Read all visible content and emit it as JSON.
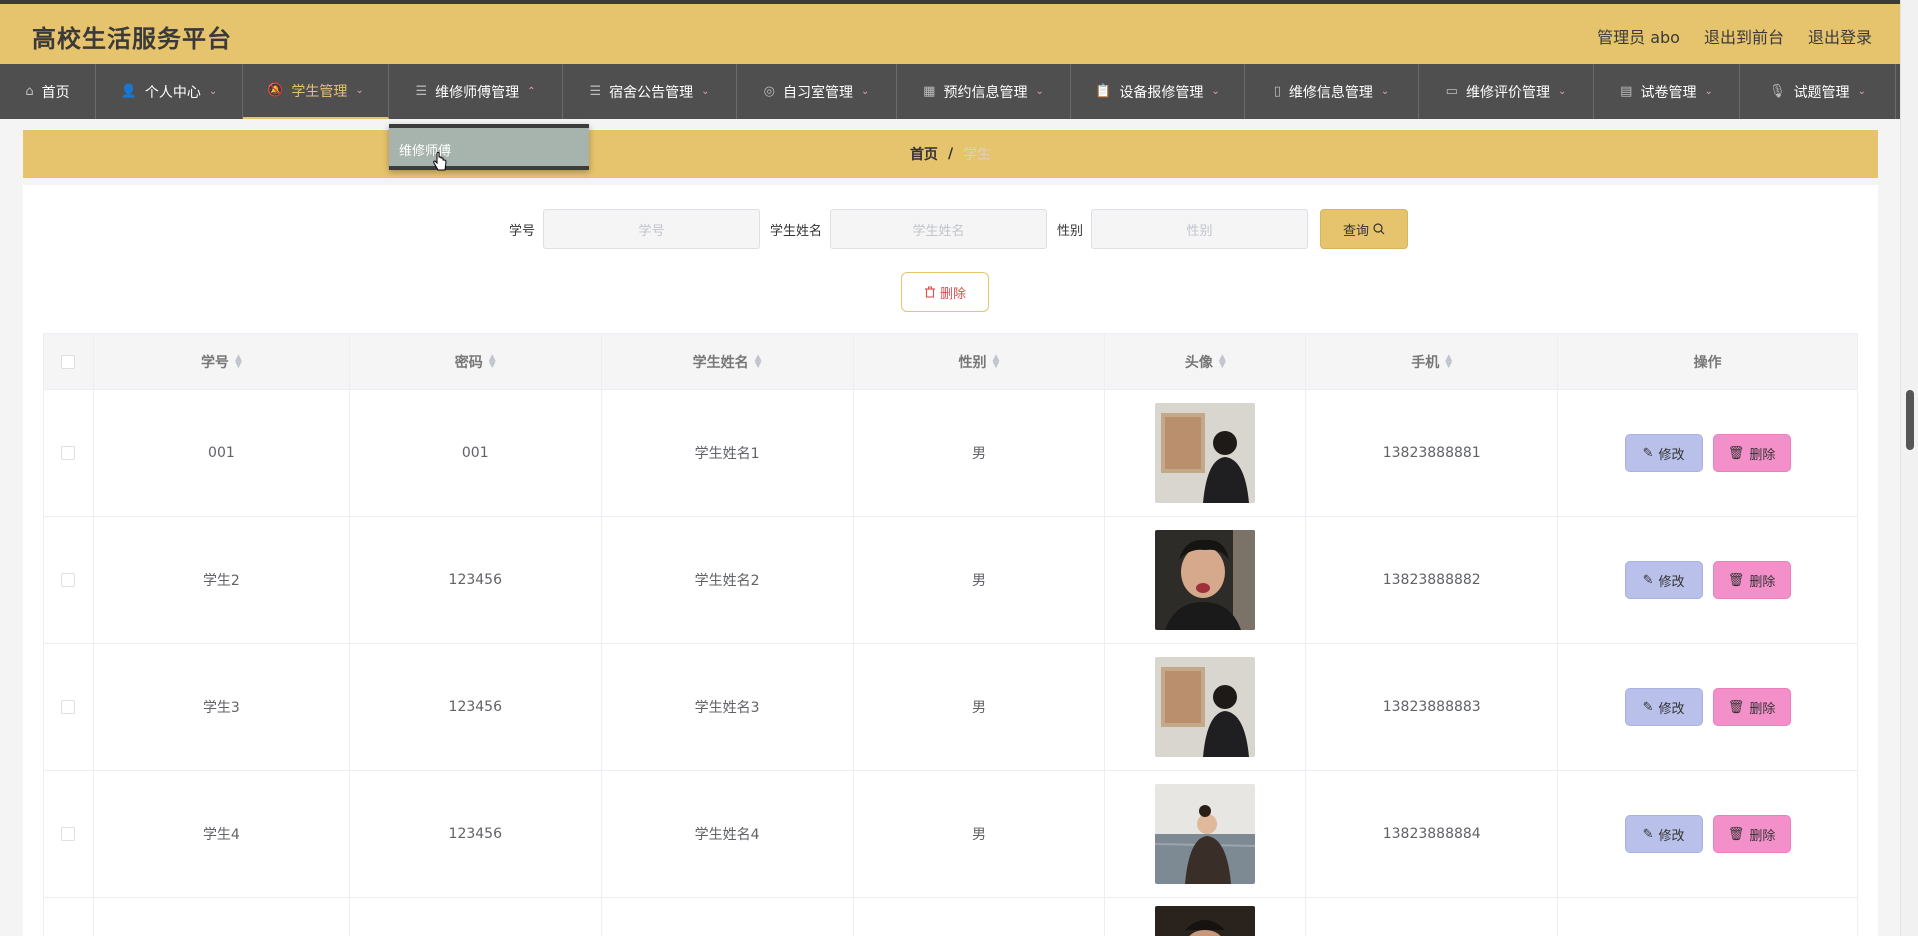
{
  "app": {
    "title": "高校生活服务平台"
  },
  "header": {
    "user_label": "管理员 abo",
    "to_front": "退出到前台",
    "logout": "退出登录"
  },
  "nav": [
    {
      "label": "首页",
      "icon": "home-icon",
      "has_menu": false
    },
    {
      "label": "个人中心",
      "icon": "user-icon",
      "has_menu": true
    },
    {
      "label": "学生管理",
      "icon": "bell-icon",
      "has_menu": true,
      "active": true
    },
    {
      "label": "维修师傅管理",
      "icon": "list-icon",
      "has_menu": true,
      "open": true
    },
    {
      "label": "宿舍公告管理",
      "icon": "list-icon",
      "has_menu": true
    },
    {
      "label": "自习室管理",
      "icon": "compass-icon",
      "has_menu": true
    },
    {
      "label": "预约信息管理",
      "icon": "grid-icon",
      "has_menu": true
    },
    {
      "label": "设备报修管理",
      "icon": "clipboard-icon",
      "has_menu": true
    },
    {
      "label": "维修信息管理",
      "icon": "mobile-icon",
      "has_menu": true
    },
    {
      "label": "维修评价管理",
      "icon": "monitor-icon",
      "has_menu": true
    },
    {
      "label": "试卷管理",
      "icon": "chart-icon",
      "has_menu": true
    },
    {
      "label": "试题管理",
      "icon": "mic-icon",
      "has_menu": true
    }
  ],
  "dropdown": {
    "item": "维修师傅"
  },
  "breadcrumb": {
    "home": "首页",
    "separator": "/",
    "current": "学生"
  },
  "search": {
    "fields": [
      {
        "label": "学号",
        "placeholder": "学号"
      },
      {
        "label": "学生姓名",
        "placeholder": "学生姓名"
      },
      {
        "label": "性别",
        "placeholder": "性别"
      }
    ],
    "query_label": "查询"
  },
  "toolbar": {
    "delete_label": "删除"
  },
  "table": {
    "columns": [
      "学号",
      "密码",
      "学生姓名",
      "性别",
      "头像",
      "手机",
      "操作"
    ],
    "rows": [
      {
        "id": "001",
        "password": "001",
        "name": "学生姓名1",
        "gender": "男",
        "avatar": "avatar-back",
        "phone": "13823888881"
      },
      {
        "id": "学生2",
        "password": "123456",
        "name": "学生姓名2",
        "gender": "男",
        "avatar": "avatar-face",
        "phone": "13823888882"
      },
      {
        "id": "学生3",
        "password": "123456",
        "name": "学生姓名3",
        "gender": "男",
        "avatar": "avatar-back",
        "phone": "13823888883"
      },
      {
        "id": "学生4",
        "password": "123456",
        "name": "学生姓名4",
        "gender": "男",
        "avatar": "avatar-sea",
        "phone": "13823888884"
      }
    ],
    "edit_label": "修改",
    "delete_label": "删除"
  },
  "colors": {
    "accent": "#e6c36d",
    "nav_bg": "#4f4f4f",
    "edit_btn": "#b9c1ea",
    "delete_btn": "#f38fc9"
  }
}
